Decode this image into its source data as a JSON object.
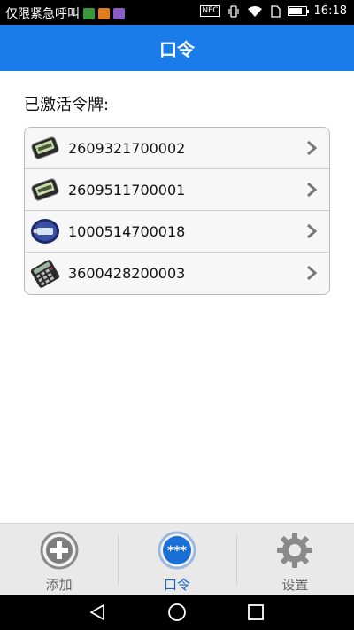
{
  "status_bar": {
    "carrier_text": "仅限紧急呼叫",
    "nfc_label": "NFC",
    "time": "16:18",
    "battery_level": 0.75,
    "notification_icons": [
      "sms-app-icon",
      "orange-app-icon",
      "purple-app-icon"
    ]
  },
  "header": {
    "title": "口令"
  },
  "tokens": {
    "section_title": "已激活令牌:",
    "items": [
      {
        "serial": "2609321700002",
        "icon": "lcd-token-icon"
      },
      {
        "serial": "2609511700001",
        "icon": "lcd-token-icon"
      },
      {
        "serial": "1000514700018",
        "icon": "keyfob-token-icon"
      },
      {
        "serial": "3600428200003",
        "icon": "calculator-token-icon"
      }
    ]
  },
  "tabbar": {
    "tabs": [
      {
        "label": "添加",
        "icon": "plus-icon",
        "active": false
      },
      {
        "label": "口令",
        "icon": "password-dots-icon",
        "active": true
      },
      {
        "label": "设置",
        "icon": "gear-icon",
        "active": false
      }
    ]
  },
  "colors": {
    "accent": "#1a7ce8",
    "active_tab": "#1a66c8",
    "tab_bar_bg": "#e9e9e9"
  }
}
